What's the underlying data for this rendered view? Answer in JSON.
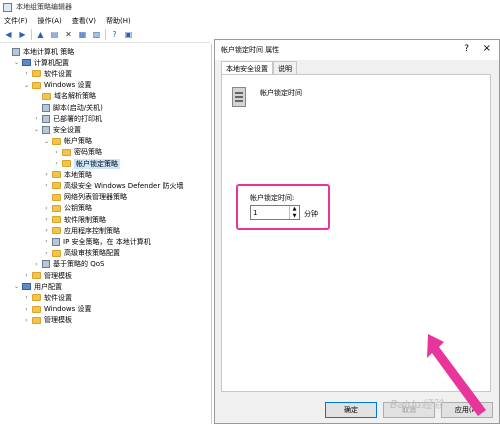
{
  "window": {
    "title": "本地组策略编辑器"
  },
  "menu": [
    "文件(F)",
    "操作(A)",
    "查看(V)",
    "帮助(H)"
  ],
  "toolbar_icons": [
    "back-icon",
    "forward-icon",
    "folder-up-icon",
    "show-hide-tree-icon",
    "delete-icon",
    "properties-icon",
    "export-icon",
    "help-icon",
    "view-icon"
  ],
  "tree": [
    {
      "label": "本地计算机 策略",
      "indent": 0,
      "icon": "policy",
      "chev": ""
    },
    {
      "label": "计算机配置",
      "indent": 1,
      "icon": "pc",
      "chev": "v"
    },
    {
      "label": "软件设置",
      "indent": 2,
      "icon": "folder",
      "chev": ">"
    },
    {
      "label": "Windows 设置",
      "indent": 2,
      "icon": "folder",
      "chev": "v"
    },
    {
      "label": "域名解析策略",
      "indent": 3,
      "icon": "folder",
      "chev": ""
    },
    {
      "label": "脚本(启动/关机)",
      "indent": 3,
      "icon": "doc",
      "chev": ""
    },
    {
      "label": "已部署的打印机",
      "indent": 3,
      "icon": "doc",
      "chev": ">"
    },
    {
      "label": "安全设置",
      "indent": 3,
      "icon": "sec",
      "chev": "v"
    },
    {
      "label": "帐户策略",
      "indent": 4,
      "icon": "folder",
      "chev": "v"
    },
    {
      "label": "密码策略",
      "indent": 5,
      "icon": "folder",
      "chev": ">"
    },
    {
      "label": "帐户锁定策略",
      "indent": 5,
      "icon": "folder",
      "chev": ">",
      "selected": true
    },
    {
      "label": "本地策略",
      "indent": 4,
      "icon": "folder",
      "chev": ">"
    },
    {
      "label": "高级安全 Windows Defender 防火墙",
      "indent": 4,
      "icon": "folder",
      "chev": ">"
    },
    {
      "label": "网络列表管理器策略",
      "indent": 4,
      "icon": "folder",
      "chev": ""
    },
    {
      "label": "公钥策略",
      "indent": 4,
      "icon": "folder",
      "chev": ">"
    },
    {
      "label": "软件限制策略",
      "indent": 4,
      "icon": "folder",
      "chev": ">"
    },
    {
      "label": "应用程序控制策略",
      "indent": 4,
      "icon": "folder",
      "chev": ">"
    },
    {
      "label": "IP 安全策略，在 本地计算机",
      "indent": 4,
      "icon": "sec",
      "chev": ">"
    },
    {
      "label": "高级审核策略配置",
      "indent": 4,
      "icon": "folder",
      "chev": ">"
    },
    {
      "label": "基于策略的 QoS",
      "indent": 3,
      "icon": "sec",
      "chev": ">"
    },
    {
      "label": "管理模板",
      "indent": 2,
      "icon": "folder",
      "chev": ">"
    },
    {
      "label": "用户配置",
      "indent": 1,
      "icon": "pc",
      "chev": "v"
    },
    {
      "label": "软件设置",
      "indent": 2,
      "icon": "folder",
      "chev": ">"
    },
    {
      "label": "Windows 设置",
      "indent": 2,
      "icon": "folder",
      "chev": ">"
    },
    {
      "label": "管理模板",
      "indent": 2,
      "icon": "folder",
      "chev": ">"
    }
  ],
  "dialog": {
    "title": "帐户锁定时间 属性",
    "help": "?",
    "close": "×",
    "tabs": [
      "本地安全设置",
      "说明"
    ],
    "policy_name": "帐户锁定时间",
    "field_label": "帐户锁定时间:",
    "value": "1",
    "unit": "分钟",
    "buttons": {
      "ok": "确定",
      "cancel": "取消",
      "apply": "应用(A)"
    }
  },
  "accent": "#e8359c",
  "watermark": "Baidu经验"
}
